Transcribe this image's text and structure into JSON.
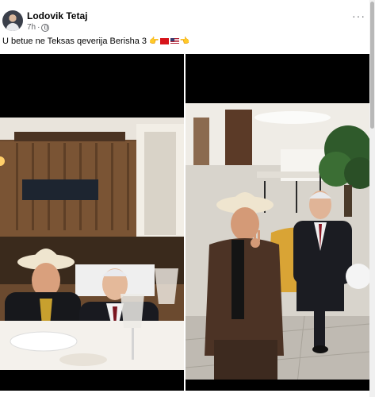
{
  "post": {
    "author": "Lodovik Tetaj",
    "time": "7h",
    "separator": "·",
    "more_label": "···",
    "caption": {
      "text": "U  betue  ne Teksas qeverija Berisha 3",
      "emojis": [
        "pointing-hand",
        "albania-flag",
        "us-flag",
        "pointing-hand"
      ]
    }
  },
  "photos": [
    {
      "name": "restaurant-photo",
      "subject": "two men seated at a restaurant table"
    },
    {
      "name": "lobby-photo",
      "subject": "two men seated in a hotel lobby"
    }
  ],
  "colors": {
    "text": "#050505",
    "secondary": "#65676b",
    "background": "#ffffff"
  }
}
